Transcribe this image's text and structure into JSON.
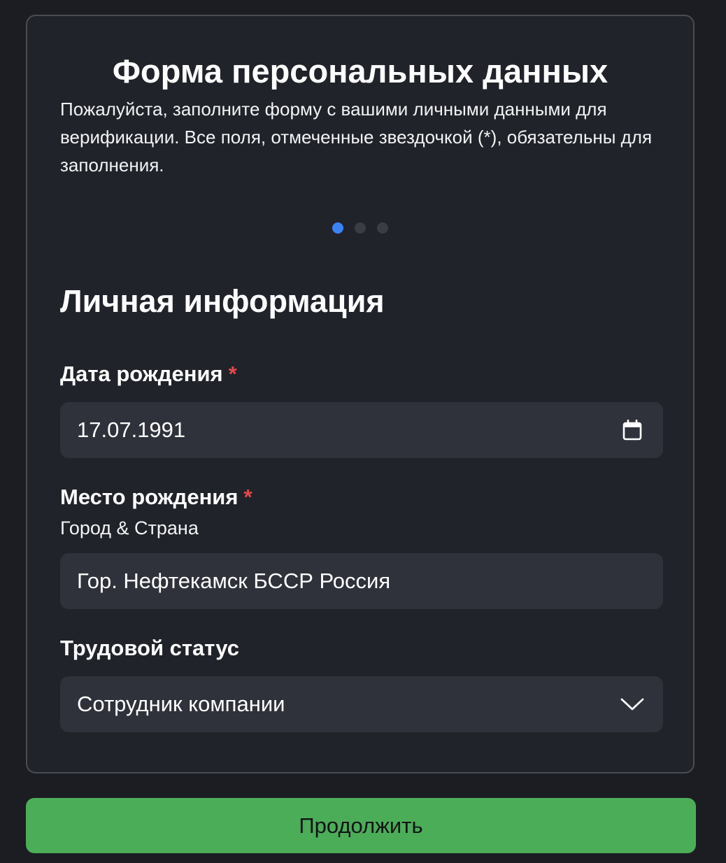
{
  "form": {
    "title": "Форма персональных данных",
    "description": "Пожалуйста, заполните форму с вашими личными данными для верификации. Все поля, отмеченные звездочкой (*), обязательны для заполнения.",
    "steps": {
      "total": 3,
      "current": 1
    },
    "section_title": "Личная информация",
    "required_marker": "*"
  },
  "fields": {
    "birth_date": {
      "label": "Дата рождения",
      "value": "17.07.1991",
      "icon": "calendar-icon"
    },
    "birth_place": {
      "label": "Место рождения",
      "hint": "Город & Страна",
      "value": "Гор. Нефтекамск БССР Россия"
    },
    "employment_status": {
      "label": "Трудовой статус",
      "value": "Сотрудник компании",
      "icon": "chevron-down-icon"
    }
  },
  "actions": {
    "continue_label": "Продолжить"
  },
  "colors": {
    "accent": "#3b82f6",
    "required": "#e5484d",
    "button": "#4cad58",
    "card_background": "#202329",
    "field_background": "#2f323a"
  }
}
